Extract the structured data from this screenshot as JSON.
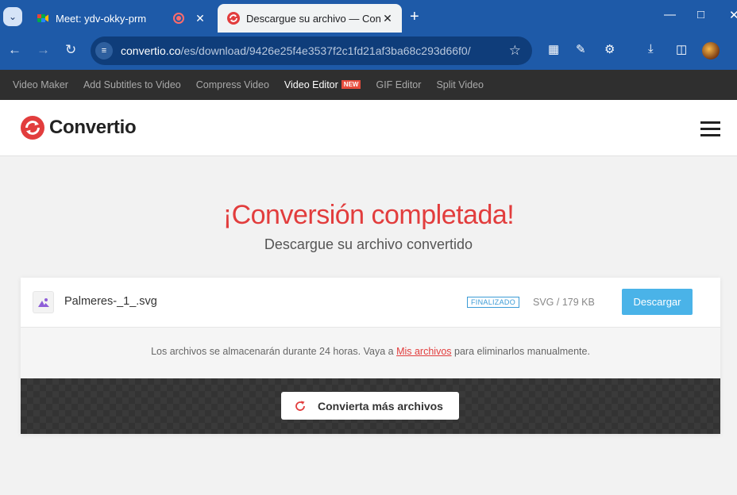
{
  "browser": {
    "tabs": [
      {
        "title": "Meet: ydv-okky-prm",
        "active": false
      },
      {
        "title": "Descargue su archivo — Convertio",
        "active": true
      }
    ],
    "url_host": "convertio.co",
    "url_path": "/es/download/9426e25f4e3537f2c1fd21af3ba68c293d66f0/"
  },
  "sitenav": {
    "items": [
      "Video Maker",
      "Add Subtitles to Video",
      "Compress Video",
      "Video Editor",
      "GIF Editor",
      "Split Video"
    ],
    "new_badge": "NEW"
  },
  "header": {
    "logo_text": "Convertio"
  },
  "main": {
    "headline": "¡Conversión completada!",
    "subheadline": "Descargue su archivo convertido",
    "file": {
      "name": "Palmeres-_1_.svg",
      "status": "FINALIZADO",
      "size": "SVG / 179 KB",
      "download_label": "Descargar"
    },
    "note_before": "Los archivos se almacenarán durante 24 horas. Vaya a",
    "note_link": "Mis archivos",
    "note_after": "para eliminarlos manualmente.",
    "more_label": "Convierta más archivos"
  },
  "colors": {
    "browser_blue": "#1e5aa8",
    "brand_red": "#e23d3d",
    "download_blue": "#4ab3e8",
    "nav_dark": "#2f2f2f"
  },
  "icons": [
    "chevron-down-icon",
    "meet-icon",
    "record-icon",
    "close-icon",
    "convertio-icon",
    "plus-icon",
    "minimize-icon",
    "maximize-icon",
    "back-icon",
    "forward-icon",
    "reload-icon",
    "site-settings-icon",
    "star-icon",
    "translate-icon",
    "eyedropper-icon",
    "extensions-icon",
    "download-icon",
    "sidepanel-icon",
    "image-icon",
    "refresh-icon",
    "hamburger-icon"
  ]
}
